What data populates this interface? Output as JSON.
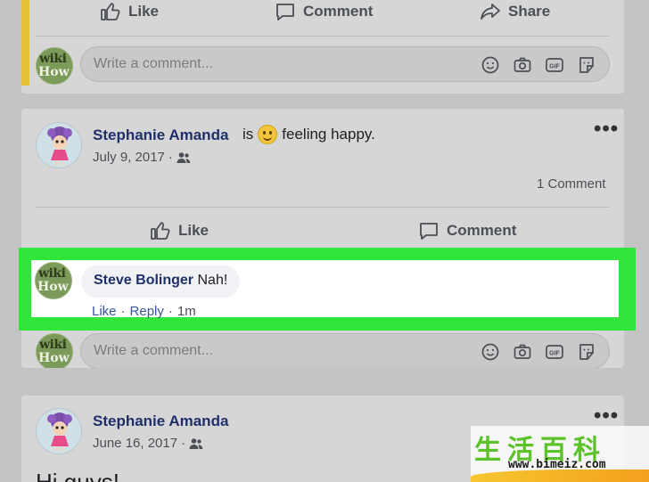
{
  "top_card": {
    "actions": {
      "like": "Like",
      "comment": "Comment",
      "share": "Share"
    },
    "comment_placeholder": "Write a comment..."
  },
  "avatar_text": {
    "line1": "wiki",
    "line2": "How"
  },
  "post1": {
    "author": "Stephanie Amanda",
    "status_is": "is",
    "feeling": "feeling happy.",
    "date": "July 9, 2017",
    "date_separator": "·",
    "comment_count": "1 Comment",
    "actions": {
      "like": "Like",
      "comment": "Comment"
    },
    "comment": {
      "author": "Steve Bolinger",
      "text": "Nah!",
      "like": "Like",
      "reply": "Reply",
      "time": "1m",
      "separator": "·"
    },
    "comment_placeholder": "Write a comment..."
  },
  "post2": {
    "author": "Stephanie Amanda",
    "date": "June 16, 2017",
    "date_separator": "·",
    "text": "Hi guys!"
  },
  "watermark": {
    "title": "生活百科",
    "url": "www.bimeiz.com"
  },
  "colors": {
    "highlight": "#31e63b",
    "name_link": "#1f2f6a",
    "accent": "#e3bf3a"
  },
  "icons": [
    "thumbs-up-icon",
    "comment-icon",
    "share-icon",
    "emoji-icon",
    "camera-icon",
    "gif-icon",
    "sticker-icon",
    "audience-icon",
    "more-icon"
  ]
}
